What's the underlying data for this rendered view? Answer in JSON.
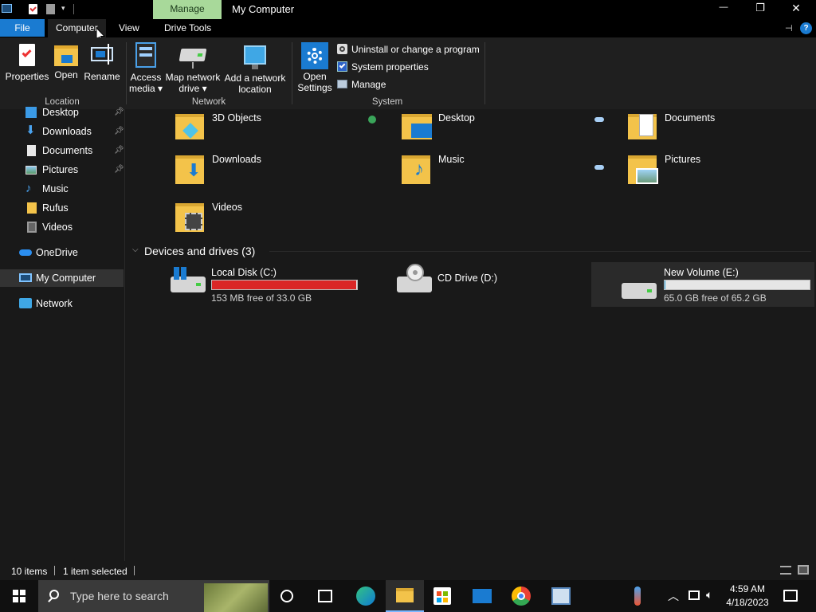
{
  "window": {
    "title": "My Computer",
    "context_tab": "Manage",
    "min_glyph": "—",
    "max_glyph": "❐",
    "close_glyph": "✕"
  },
  "tabs": {
    "file": "File",
    "computer": "Computer",
    "view": "View",
    "drive_tools": "Drive Tools"
  },
  "ribbon": {
    "location": {
      "label": "Location",
      "properties": "Properties",
      "open": "Open",
      "rename": "Rename"
    },
    "network": {
      "label": "Network",
      "access_media": [
        "Access",
        "media ▾"
      ],
      "map_drive": [
        "Map network",
        "drive ▾"
      ],
      "add_location": [
        "Add a network",
        "location"
      ]
    },
    "system": {
      "label": "System",
      "open_settings": [
        "Open",
        "Settings"
      ],
      "uninstall": "Uninstall or change a program",
      "system_properties": "System properties",
      "manage": "Manage"
    }
  },
  "nav": {
    "items": [
      {
        "label": "Desktop",
        "pinned": true
      },
      {
        "label": "Downloads",
        "pinned": true
      },
      {
        "label": "Documents",
        "pinned": true
      },
      {
        "label": "Pictures",
        "pinned": true
      },
      {
        "label": "Music",
        "pinned": false
      },
      {
        "label": "Rufus",
        "pinned": false
      },
      {
        "label": "Videos",
        "pinned": false
      }
    ],
    "onedrive": "OneDrive",
    "mycomputer": "My Computer",
    "network": "Network"
  },
  "folders": [
    "3D Objects",
    "Desktop",
    "Documents",
    "Downloads",
    "Music",
    "Pictures",
    "Videos"
  ],
  "devices": {
    "header": "Devices and drives (3)",
    "drives": [
      {
        "name": "Local Disk (C:)",
        "free": "153 MB free of 33.0 GB",
        "used_fraction": 0.995,
        "bar_color": "#da2626"
      },
      {
        "name": "CD Drive (D:)"
      },
      {
        "name": "New Volume (E:)",
        "free": "65.0 GB free of 65.2 GB",
        "used_fraction": 0.003,
        "bar_color": "#26a0da"
      }
    ]
  },
  "status": {
    "items": "10 items",
    "selected": "1 item selected"
  },
  "taskbar": {
    "search_placeholder": "Type here to search",
    "time": "4:59 AM",
    "date": "4/18/2023"
  }
}
